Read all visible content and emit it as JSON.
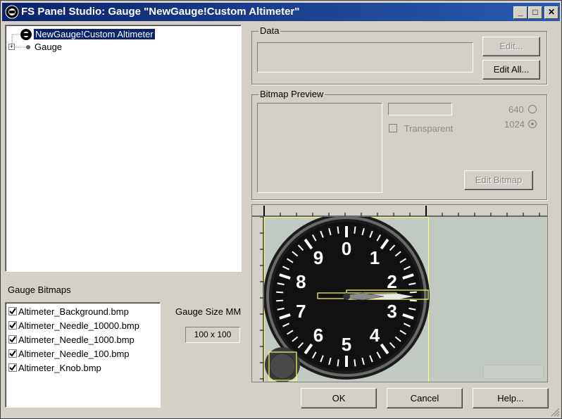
{
  "window": {
    "title": "FS Panel Studio: Gauge \"NewGauge!Custom Altimeter\"",
    "controls": {
      "minimize": "_",
      "maximize": "□",
      "close": "✕"
    }
  },
  "tree": {
    "root_label": "NewGauge!Custom Altimeter",
    "child_label": "Gauge",
    "expander": "+"
  },
  "bitmaps": {
    "heading": "Gauge Bitmaps",
    "items": [
      "Altimeter_Background.bmp",
      "Altimeter_Needle_10000.bmp",
      "Altimeter_Needle_1000.bmp",
      "Altimeter_Needle_100.bmp",
      "Altimeter_Knob.bmp"
    ]
  },
  "gauge_size": {
    "label": "Gauge Size MM",
    "value": "100 x 100"
  },
  "data_group": {
    "title": "Data",
    "edit_label": "Edit...",
    "edit_all_label": "Edit All..."
  },
  "bitmap_preview": {
    "title": "Bitmap Preview",
    "transparent_label": "Transparent",
    "res_640": "640",
    "res_1024": "1024",
    "selected_res": "1024",
    "edit_bitmap_label": "Edit Bitmap"
  },
  "dial": {
    "numerals": [
      "0",
      "1",
      "2",
      "3",
      "4",
      "5",
      "6",
      "7",
      "8",
      "9"
    ]
  },
  "buttons": {
    "ok": "OK",
    "cancel": "Cancel",
    "help": "Help..."
  },
  "colors": {
    "title_start": "#0a246a",
    "title_end": "#2a5bb0",
    "canvas_bg": "#c1cac0",
    "highlight": "#ffff66"
  }
}
